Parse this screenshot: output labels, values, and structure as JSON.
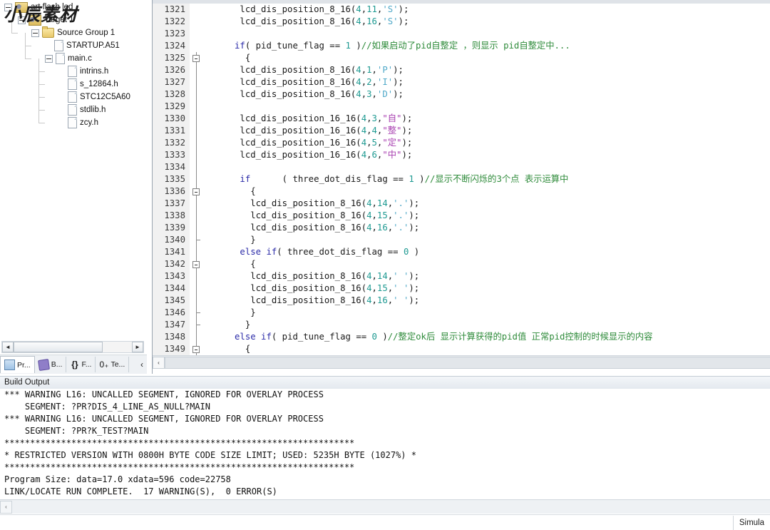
{
  "window": {
    "watermark": "小辰素材",
    "status_right": "Simula"
  },
  "sidebar": {
    "tree": [
      {
        "label": "art flash led",
        "icon": "project-icon",
        "depth": 0,
        "expander": "minus"
      },
      {
        "label": "Target 1",
        "icon": "target-icon",
        "depth": 1,
        "expander": "minus"
      },
      {
        "label": "Source Group 1",
        "icon": "folder-icon",
        "depth": 2,
        "expander": "minus"
      },
      {
        "label": "STARTUP.A51",
        "icon": "file-icon",
        "depth": 3,
        "expander": "none"
      },
      {
        "label": "main.c",
        "icon": "file-icon",
        "depth": 3,
        "expander": "minus"
      },
      {
        "label": "intrins.h",
        "icon": "file-icon",
        "depth": 4,
        "expander": "none"
      },
      {
        "label": "s_12864.h",
        "icon": "file-icon",
        "depth": 4,
        "expander": "none"
      },
      {
        "label": "STC12C5A60",
        "icon": "file-icon",
        "depth": 4,
        "expander": "none"
      },
      {
        "label": "stdlib.h",
        "icon": "file-icon",
        "depth": 4,
        "expander": "none"
      },
      {
        "label": "zcy.h",
        "icon": "file-icon",
        "depth": 4,
        "expander": "none"
      }
    ],
    "tabs": [
      {
        "label": "Pr...",
        "icon": "project-window-icon",
        "active": true
      },
      {
        "label": "B...",
        "icon": "books-icon",
        "active": false
      },
      {
        "label": "F...",
        "icon": "functions-icon",
        "active": false
      },
      {
        "label": "Te...",
        "icon": "templates-icon",
        "active": false
      }
    ],
    "scroll_left_arrow": "◄",
    "scroll_right_arrow": "►",
    "tabs_overflow_arrow": "‹"
  },
  "editor": {
    "scroll_left_arrow": "‹",
    "lines": [
      {
        "n": "1321",
        "fold": "none",
        "tokens": [
          {
            "t": "      lcd_dis_position_8_16(",
            "c": "plain"
          },
          {
            "t": "4",
            "c": "num"
          },
          {
            "t": ",",
            "c": "plain"
          },
          {
            "t": "11",
            "c": "num"
          },
          {
            "t": ",",
            "c": "plain"
          },
          {
            "t": "'S'",
            "c": "str"
          },
          {
            "t": ");",
            "c": "plain"
          }
        ]
      },
      {
        "n": "1322",
        "fold": "none",
        "tokens": [
          {
            "t": "      lcd_dis_position_8_16(",
            "c": "plain"
          },
          {
            "t": "4",
            "c": "num"
          },
          {
            "t": ",",
            "c": "plain"
          },
          {
            "t": "16",
            "c": "num"
          },
          {
            "t": ",",
            "c": "plain"
          },
          {
            "t": "'S'",
            "c": "str"
          },
          {
            "t": ");",
            "c": "plain"
          }
        ]
      },
      {
        "n": "1323",
        "fold": "none",
        "tokens": [
          {
            "t": "",
            "c": "plain"
          }
        ]
      },
      {
        "n": "1324",
        "fold": "none",
        "tokens": [
          {
            "t": "     ",
            "c": "plain"
          },
          {
            "t": "if",
            "c": "kw"
          },
          {
            "t": "( pid_tune_flag == ",
            "c": "plain"
          },
          {
            "t": "1",
            "c": "num"
          },
          {
            "t": " )",
            "c": "plain"
          },
          {
            "t": "//如果启动了pid自整定 ，则显示 pid自整定中...",
            "c": "cmt"
          }
        ]
      },
      {
        "n": "1325",
        "fold": "box",
        "tokens": [
          {
            "t": "       {",
            "c": "plain"
          }
        ]
      },
      {
        "n": "1326",
        "fold": "line",
        "tokens": [
          {
            "t": "      lcd_dis_position_8_16(",
            "c": "plain"
          },
          {
            "t": "4",
            "c": "num"
          },
          {
            "t": ",",
            "c": "plain"
          },
          {
            "t": "1",
            "c": "num"
          },
          {
            "t": ",",
            "c": "plain"
          },
          {
            "t": "'P'",
            "c": "str"
          },
          {
            "t": ");",
            "c": "plain"
          }
        ]
      },
      {
        "n": "1327",
        "fold": "line",
        "tokens": [
          {
            "t": "      lcd_dis_position_8_16(",
            "c": "plain"
          },
          {
            "t": "4",
            "c": "num"
          },
          {
            "t": ",",
            "c": "plain"
          },
          {
            "t": "2",
            "c": "num"
          },
          {
            "t": ",",
            "c": "plain"
          },
          {
            "t": "'I'",
            "c": "str"
          },
          {
            "t": ");",
            "c": "plain"
          }
        ]
      },
      {
        "n": "1328",
        "fold": "line",
        "tokens": [
          {
            "t": "      lcd_dis_position_8_16(",
            "c": "plain"
          },
          {
            "t": "4",
            "c": "num"
          },
          {
            "t": ",",
            "c": "plain"
          },
          {
            "t": "3",
            "c": "num"
          },
          {
            "t": ",",
            "c": "plain"
          },
          {
            "t": "'D'",
            "c": "str"
          },
          {
            "t": ");",
            "c": "plain"
          }
        ]
      },
      {
        "n": "1329",
        "fold": "line",
        "tokens": [
          {
            "t": "",
            "c": "plain"
          }
        ]
      },
      {
        "n": "1330",
        "fold": "line",
        "tokens": [
          {
            "t": "      lcd_dis_position_16_16(",
            "c": "plain"
          },
          {
            "t": "4",
            "c": "num"
          },
          {
            "t": ",",
            "c": "plain"
          },
          {
            "t": "3",
            "c": "num"
          },
          {
            "t": ",",
            "c": "plain"
          },
          {
            "t": "\"自\"",
            "c": "strcn"
          },
          {
            "t": ");",
            "c": "plain"
          }
        ]
      },
      {
        "n": "1331",
        "fold": "line",
        "tokens": [
          {
            "t": "      lcd_dis_position_16_16(",
            "c": "plain"
          },
          {
            "t": "4",
            "c": "num"
          },
          {
            "t": ",",
            "c": "plain"
          },
          {
            "t": "4",
            "c": "num"
          },
          {
            "t": ",",
            "c": "plain"
          },
          {
            "t": "\"整\"",
            "c": "strcn"
          },
          {
            "t": ");",
            "c": "plain"
          }
        ]
      },
      {
        "n": "1332",
        "fold": "line",
        "tokens": [
          {
            "t": "      lcd_dis_position_16_16(",
            "c": "plain"
          },
          {
            "t": "4",
            "c": "num"
          },
          {
            "t": ",",
            "c": "plain"
          },
          {
            "t": "5",
            "c": "num"
          },
          {
            "t": ",",
            "c": "plain"
          },
          {
            "t": "\"定\"",
            "c": "strcn"
          },
          {
            "t": ");",
            "c": "plain"
          }
        ]
      },
      {
        "n": "1333",
        "fold": "line",
        "tokens": [
          {
            "t": "      lcd_dis_position_16_16(",
            "c": "plain"
          },
          {
            "t": "4",
            "c": "num"
          },
          {
            "t": ",",
            "c": "plain"
          },
          {
            "t": "6",
            "c": "num"
          },
          {
            "t": ",",
            "c": "plain"
          },
          {
            "t": "\"中\"",
            "c": "strcn"
          },
          {
            "t": ");",
            "c": "plain"
          }
        ]
      },
      {
        "n": "1334",
        "fold": "line",
        "tokens": [
          {
            "t": "",
            "c": "plain"
          }
        ]
      },
      {
        "n": "1335",
        "fold": "line",
        "tokens": [
          {
            "t": "      ",
            "c": "plain"
          },
          {
            "t": "if",
            "c": "kw"
          },
          {
            "t": "      ( three_dot_dis_flag == ",
            "c": "plain"
          },
          {
            "t": "1",
            "c": "num"
          },
          {
            "t": " )",
            "c": "plain"
          },
          {
            "t": "//显示不断闪烁的3个点 表示运算中",
            "c": "cmt"
          }
        ]
      },
      {
        "n": "1336",
        "fold": "box",
        "tokens": [
          {
            "t": "        {",
            "c": "plain"
          }
        ]
      },
      {
        "n": "1337",
        "fold": "line",
        "tokens": [
          {
            "t": "        lcd_dis_position_8_16(",
            "c": "plain"
          },
          {
            "t": "4",
            "c": "num"
          },
          {
            "t": ",",
            "c": "plain"
          },
          {
            "t": "14",
            "c": "num"
          },
          {
            "t": ",",
            "c": "plain"
          },
          {
            "t": "'.'",
            "c": "str"
          },
          {
            "t": ");",
            "c": "plain"
          }
        ]
      },
      {
        "n": "1338",
        "fold": "line",
        "tokens": [
          {
            "t": "        lcd_dis_position_8_16(",
            "c": "plain"
          },
          {
            "t": "4",
            "c": "num"
          },
          {
            "t": ",",
            "c": "plain"
          },
          {
            "t": "15",
            "c": "num"
          },
          {
            "t": ",",
            "c": "plain"
          },
          {
            "t": "'.'",
            "c": "str"
          },
          {
            "t": ");",
            "c": "plain"
          }
        ]
      },
      {
        "n": "1339",
        "fold": "line",
        "tokens": [
          {
            "t": "        lcd_dis_position_8_16(",
            "c": "plain"
          },
          {
            "t": "4",
            "c": "num"
          },
          {
            "t": ",",
            "c": "plain"
          },
          {
            "t": "16",
            "c": "num"
          },
          {
            "t": ",",
            "c": "plain"
          },
          {
            "t": "'.'",
            "c": "str"
          },
          {
            "t": ");",
            "c": "plain"
          }
        ]
      },
      {
        "n": "1340",
        "fold": "tick",
        "tokens": [
          {
            "t": "        }",
            "c": "plain"
          }
        ]
      },
      {
        "n": "1341",
        "fold": "line",
        "tokens": [
          {
            "t": "      ",
            "c": "plain"
          },
          {
            "t": "else if",
            "c": "kw"
          },
          {
            "t": "( three_dot_dis_flag == ",
            "c": "plain"
          },
          {
            "t": "0",
            "c": "num"
          },
          {
            "t": " )",
            "c": "plain"
          }
        ]
      },
      {
        "n": "1342",
        "fold": "box",
        "tokens": [
          {
            "t": "        {",
            "c": "plain"
          }
        ]
      },
      {
        "n": "1343",
        "fold": "line",
        "tokens": [
          {
            "t": "        lcd_dis_position_8_16(",
            "c": "plain"
          },
          {
            "t": "4",
            "c": "num"
          },
          {
            "t": ",",
            "c": "plain"
          },
          {
            "t": "14",
            "c": "num"
          },
          {
            "t": ",",
            "c": "plain"
          },
          {
            "t": "' '",
            "c": "str"
          },
          {
            "t": ");",
            "c": "plain"
          }
        ]
      },
      {
        "n": "1344",
        "fold": "line",
        "tokens": [
          {
            "t": "        lcd_dis_position_8_16(",
            "c": "plain"
          },
          {
            "t": "4",
            "c": "num"
          },
          {
            "t": ",",
            "c": "plain"
          },
          {
            "t": "15",
            "c": "num"
          },
          {
            "t": ",",
            "c": "plain"
          },
          {
            "t": "' '",
            "c": "str"
          },
          {
            "t": ");",
            "c": "plain"
          }
        ]
      },
      {
        "n": "1345",
        "fold": "line",
        "tokens": [
          {
            "t": "        lcd_dis_position_8_16(",
            "c": "plain"
          },
          {
            "t": "4",
            "c": "num"
          },
          {
            "t": ",",
            "c": "plain"
          },
          {
            "t": "16",
            "c": "num"
          },
          {
            "t": ",",
            "c": "plain"
          },
          {
            "t": "' '",
            "c": "str"
          },
          {
            "t": ");",
            "c": "plain"
          }
        ]
      },
      {
        "n": "1346",
        "fold": "tick",
        "tokens": [
          {
            "t": "        }",
            "c": "plain"
          }
        ]
      },
      {
        "n": "1347",
        "fold": "tick",
        "tokens": [
          {
            "t": "       }",
            "c": "plain"
          }
        ]
      },
      {
        "n": "1348",
        "fold": "line",
        "tokens": [
          {
            "t": "     ",
            "c": "plain"
          },
          {
            "t": "else if",
            "c": "kw"
          },
          {
            "t": "( pid_tune_flag == ",
            "c": "plain"
          },
          {
            "t": "0",
            "c": "num"
          },
          {
            "t": " )",
            "c": "plain"
          },
          {
            "t": "//整定ok后 显示计算获得的pid值 正常pid控制的时候显示的内容",
            "c": "cmt"
          }
        ]
      },
      {
        "n": "1349",
        "fold": "box",
        "tokens": [
          {
            "t": "       {",
            "c": "plain"
          }
        ]
      }
    ]
  },
  "build": {
    "title": "Build Output",
    "lines": [
      "*** WARNING L16: UNCALLED SEGMENT, IGNORED FOR OVERLAY PROCESS",
      "    SEGMENT: ?PR?DIS_4_LINE_AS_NULL?MAIN",
      "*** WARNING L16: UNCALLED SEGMENT, IGNORED FOR OVERLAY PROCESS",
      "    SEGMENT: ?PR?K_TEST?MAIN",
      "********************************************************************",
      "* RESTRICTED VERSION WITH 0800H BYTE CODE SIZE LIMIT; USED: 5235H BYTE (1027%) *",
      "********************************************************************",
      "Program Size: data=17.0 xdata=596 code=22758",
      "LINK/LOCATE RUN COMPLETE.  17 WARNING(S),  0 ERROR(S)"
    ],
    "scroll_left_arrow": "‹"
  }
}
